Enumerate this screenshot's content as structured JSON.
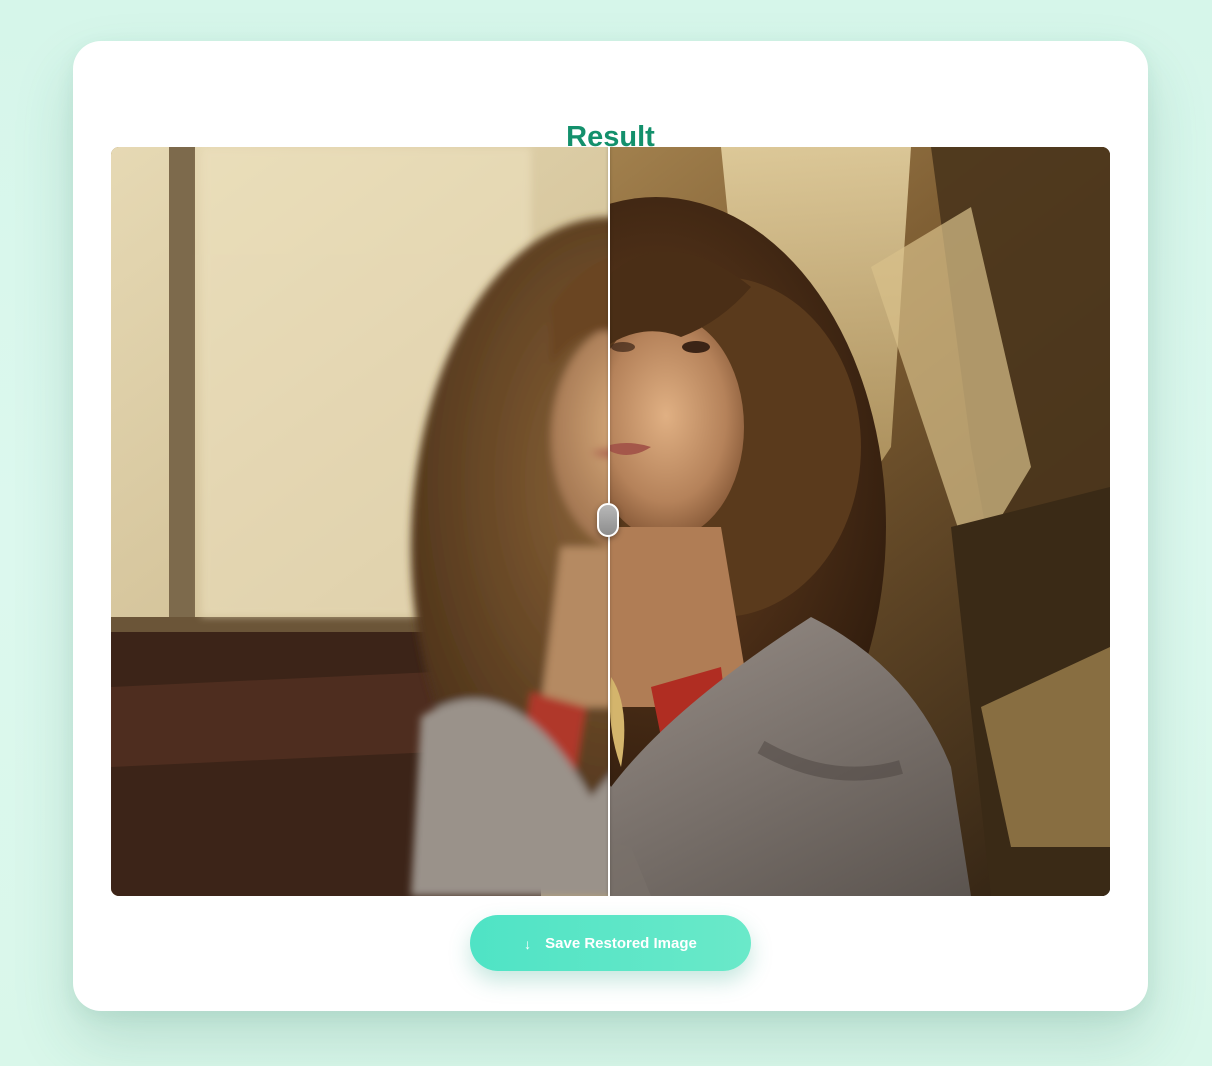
{
  "result_title": "Result",
  "comparison": {
    "before_label": "original-photo",
    "after_label": "restored-photo",
    "slider_position": 0.5
  },
  "save_button": {
    "icon": "download-arrow-icon",
    "label": "Save Restored Image"
  },
  "colors": {
    "title": "#13906c",
    "button_start": "#4fe3c5",
    "button_end": "#6ae9c9",
    "background": "#d6f6ea"
  }
}
